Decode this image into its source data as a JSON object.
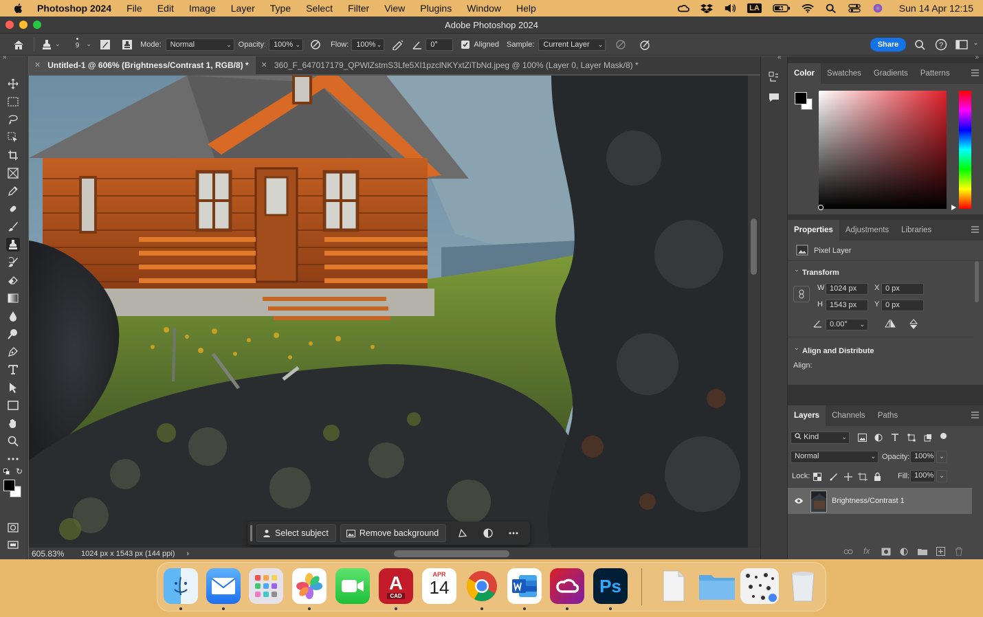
{
  "menubar": {
    "app_name": "Photoshop 2024",
    "items": [
      "File",
      "Edit",
      "Image",
      "Layer",
      "Type",
      "Select",
      "Filter",
      "View",
      "Plugins",
      "Window",
      "Help"
    ],
    "clock": "Sun 14 Apr  12:15",
    "status_icons": [
      "creative-cloud-icon",
      "dropbox-icon",
      "volume-icon",
      "la-icon",
      "battery-icon",
      "wifi-icon",
      "search-icon",
      "control-center-icon",
      "siri-icon"
    ],
    "la_label": "LA"
  },
  "window": {
    "title": "Adobe Photoshop 2024"
  },
  "options": {
    "brush_size": "9",
    "mode_label": "Mode:",
    "mode_value": "Normal",
    "opacity_label": "Opacity:",
    "opacity_value": "100%",
    "flow_label": "Flow:",
    "flow_value": "100%",
    "angle_value": "0°",
    "aligned_label": "Aligned",
    "aligned_checked": true,
    "sample_label": "Sample:",
    "sample_value": "Current Layer",
    "share_label": "Share"
  },
  "tabs": [
    {
      "label": "Untitled-1 @ 606% (Brightness/Contrast 1, RGB/8) *",
      "active": true
    },
    {
      "label": "360_F_647017179_QPWlZstmS3Lfe5XI1pzclNKYxtZiTbNd.jpeg @ 100% (Layer 0, Layer Mask/8) *",
      "active": false
    }
  ],
  "tools": [
    "move-tool-icon",
    "marquee-tool-icon",
    "lasso-tool-icon",
    "object-selection-icon",
    "crop-tool-icon",
    "frame-tool-icon",
    "eyedropper-icon",
    "healing-brush-icon",
    "brush-tool-icon",
    "clone-stamp-icon",
    "history-brush-icon",
    "eraser-icon",
    "gradient-tool-icon",
    "blur-tool-icon",
    "dodge-tool-icon",
    "pen-tool-icon",
    "type-tool-icon",
    "path-selection-icon",
    "rectangle-tool-icon",
    "hand-tool-icon",
    "zoom-tool-icon",
    "more-tools-icon"
  ],
  "status": {
    "zoom": "605.83%",
    "doc_info": "1024 px x 1543 px (144 ppi)"
  },
  "contextual_bar": {
    "select_subject": "Select subject",
    "remove_background": "Remove background"
  },
  "color_panel": {
    "tabs": [
      "Color",
      "Swatches",
      "Gradients",
      "Patterns"
    ],
    "foreground": "#000000",
    "background": "#ffffff",
    "hue": "#e0202a"
  },
  "properties_panel": {
    "tabs": [
      "Properties",
      "Adjustments",
      "Libraries"
    ],
    "layer_type": "Pixel Layer",
    "transform_title": "Transform",
    "w_label": "W",
    "w_value": "1024 px",
    "h_label": "H",
    "h_value": "1543 px",
    "x_label": "X",
    "x_value": "0 px",
    "y_label": "Y",
    "y_value": "0 px",
    "angle_value": "0.00°",
    "align_title": "Align and Distribute",
    "align_label": "Align:"
  },
  "layers_panel": {
    "tabs": [
      "Layers",
      "Channels",
      "Paths"
    ],
    "kind_label": "Kind",
    "blend_mode": "Normal",
    "opacity_label": "Opacity:",
    "opacity_value": "100%",
    "lock_label": "Lock:",
    "fill_label": "Fill:",
    "fill_value": "100%",
    "layers": [
      {
        "name": "Brightness/Contrast 1",
        "visible": true,
        "selected": true
      }
    ]
  },
  "dock": {
    "apps": [
      "Finder",
      "Mail",
      "Launchpad",
      "Photos",
      "FaceTime",
      "AutoCAD",
      "Calendar",
      "Chrome",
      "Word",
      "Creative Cloud",
      "Photoshop",
      "Documents",
      "Folder",
      "Downloads",
      "Trash"
    ],
    "calendar_month": "APR",
    "calendar_day": "14",
    "autocad_label": "CAD",
    "photoshop_label": "Ps"
  }
}
